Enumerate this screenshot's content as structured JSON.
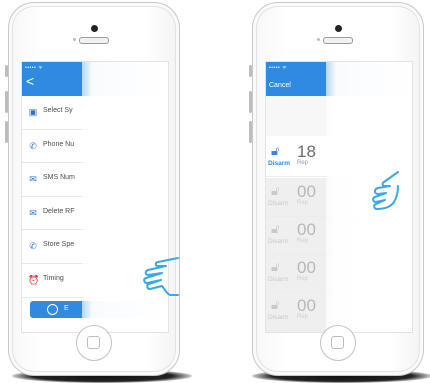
{
  "left_phone": {
    "status_text": "••••• ᯤ",
    "back_glyph": "<",
    "menu_items": [
      {
        "icon": "sim-card-icon",
        "glyph": "▣",
        "label": "Select Sy"
      },
      {
        "icon": "phone-icon",
        "glyph": "✆",
        "label": "Phone Nu"
      },
      {
        "icon": "sms-icon",
        "glyph": "✉",
        "label": "SMS Num"
      },
      {
        "icon": "delete-rf-icon",
        "glyph": "✉",
        "label": "Delete RF"
      },
      {
        "icon": "store-icon",
        "glyph": "✆",
        "label": "Store Spe"
      },
      {
        "icon": "timing-icon",
        "glyph": "⏰",
        "label": "Timing"
      }
    ],
    "bottom_button_label": "E"
  },
  "right_phone": {
    "status_text": "••••• ᯤ",
    "cancel_label": "Cancel",
    "entries": [
      {
        "label": "Disarm",
        "sub": "Rep",
        "number": "18",
        "active": true
      },
      {
        "label": "Disarm",
        "sub": "Rep",
        "number": "00",
        "active": false
      },
      {
        "label": "Disarm",
        "sub": "Rep",
        "number": "00",
        "active": false
      },
      {
        "label": "Disarm",
        "sub": "Rep",
        "number": "00",
        "active": false
      },
      {
        "label": "Disarm",
        "sub": "Rep",
        "number": "00",
        "active": false
      }
    ]
  },
  "colors": {
    "accent": "#2f8ae0",
    "icon_blue": "#2f6fcf",
    "hand_stroke": "#3aa7e6"
  },
  "icons": {
    "gesture": "pointing-hand-icon",
    "home": "home-button-icon",
    "lock": "lock-icon"
  }
}
